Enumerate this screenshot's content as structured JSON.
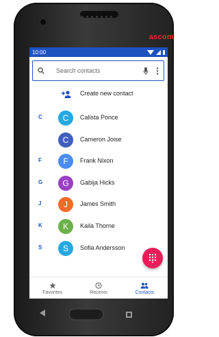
{
  "status_bar": {
    "time": "10:00"
  },
  "device": {
    "brand": "ascom"
  },
  "search": {
    "placeholder": "Search contacts"
  },
  "create_contact": {
    "label": "Create new contact"
  },
  "contacts": [
    {
      "letter": "C",
      "initial": "C",
      "name": "Calista Ponce",
      "color": "#26a7e0"
    },
    {
      "letter": "",
      "initial": "C",
      "name": "Cameron Joise",
      "color": "#3f5fbe"
    },
    {
      "letter": "F",
      "initial": "F",
      "name": "Frank Nixon",
      "color": "#4a8df0"
    },
    {
      "letter": "G",
      "initial": "G",
      "name": "Gabija Hicks",
      "color": "#9b3fc4"
    },
    {
      "letter": "J",
      "initial": "J",
      "name": "James Smith",
      "color": "#f06b2a"
    },
    {
      "letter": "K",
      "initial": "K",
      "name": "Kaila Thorne",
      "color": "#6bb04a"
    },
    {
      "letter": "S",
      "initial": "S",
      "name": "Sofia Andersson",
      "color": "#26a7e0"
    }
  ],
  "bottom_nav": [
    {
      "label": "Favorites",
      "icon": "star-icon",
      "active": false
    },
    {
      "label": "Recents",
      "icon": "clock-icon",
      "active": false
    },
    {
      "label": "Contacts",
      "icon": "people-icon",
      "active": true
    }
  ],
  "colors": {
    "primary": "#1d52c1",
    "fab": "#e81e5a",
    "brand": "#e52a24"
  }
}
